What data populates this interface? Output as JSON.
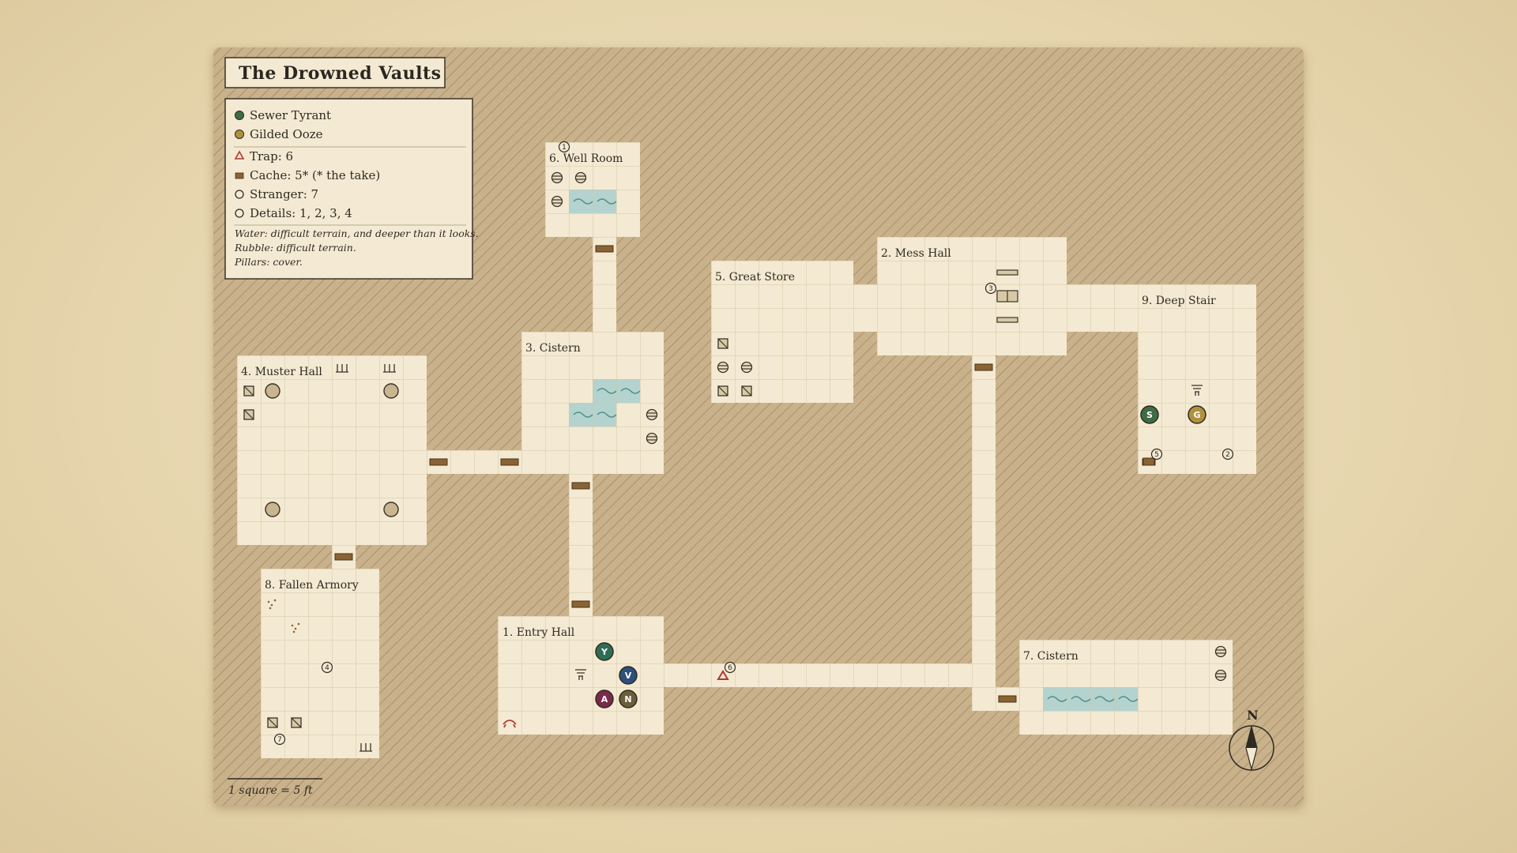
{
  "map": {
    "title": "The Drowned Vaults",
    "scale_label": "1 square = 5 ft",
    "compass_label": "N"
  },
  "legend": {
    "monsters": [
      {
        "name": "Sewer Tyrant",
        "color": "#3f6b45"
      },
      {
        "name": "Gilded Ooze",
        "color": "#b0913e"
      }
    ],
    "keys": [
      {
        "icon": "trap-icon",
        "text": "Trap: 6"
      },
      {
        "icon": "cache-icon",
        "text": "Cache: 5* (* the take)"
      },
      {
        "icon": "stranger-icon",
        "text": "Stranger: 7"
      },
      {
        "icon": "details-icon",
        "text": "Details: 1, 2, 3, 4"
      }
    ],
    "notes": [
      "Water: difficult terrain, and deeper than it looks.",
      "Rubble: difficult terrain.",
      "Pillars: cover."
    ]
  },
  "colors": {
    "floor": "#f4ead3",
    "grid": "#d3c4a3",
    "water": "#b4d3ce",
    "rock": "#c7b08a",
    "door": "#8a6335",
    "trap": "#b03a2e"
  },
  "rooms": [
    {
      "label": "1. Entry Hall"
    },
    {
      "label": "2. Mess Hall"
    },
    {
      "label": "3. Cistern"
    },
    {
      "label": "4. Muster Hall"
    },
    {
      "label": "5. Great Store"
    },
    {
      "label": "6. Well Room"
    },
    {
      "label": "7. Cistern"
    },
    {
      "label": "8. Fallen Armory"
    },
    {
      "label": "9. Deep Stair"
    }
  ],
  "tokens": [
    {
      "letter": "Y",
      "color": "#2f6e55"
    },
    {
      "letter": "V",
      "color": "#2e4f7a"
    },
    {
      "letter": "A",
      "color": "#7a2a4a"
    },
    {
      "letter": "N",
      "color": "#6b5e3a"
    },
    {
      "letter": "S",
      "color": "#3f6b45"
    },
    {
      "letter": "G",
      "color": "#b0913e"
    }
  ],
  "markers": [
    "1",
    "2",
    "3",
    "4",
    "5",
    "6",
    "7"
  ]
}
